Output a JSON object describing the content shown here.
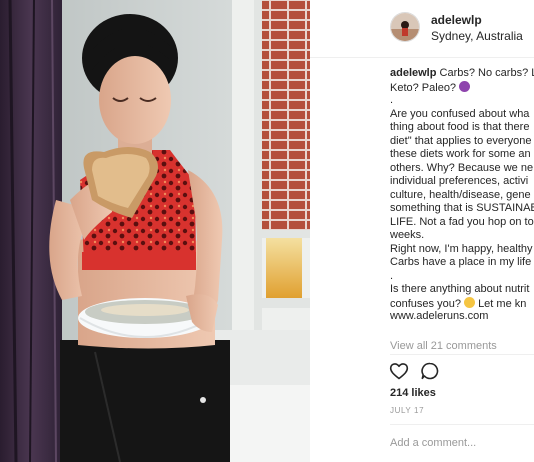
{
  "post": {
    "username": "adelewlp",
    "location": "Sydney, Australia",
    "caption_lines": [
      "Carbs? No carbs? L",
      "Keto? Paleo?",
      ".",
      "Are you confused about wha",
      "thing about food is that there",
      "diet\" that applies to everyone",
      "these diets work for some an",
      "others. Why? Because we ne",
      "individual preferences, activi",
      "culture, health/disease, gene",
      "something that is SUSTAINAB",
      "LIFE. Not a fad you hop on to",
      "weeks.",
      "Right now, I'm happy, healthy",
      "Carbs have a place in my life",
      ".",
      "Is there anything about nutrit",
      "confuses you?",
      "Let me kn",
      "www.adeleruns.com"
    ],
    "view_all_comments": "View all 21 comments",
    "likes": "214 likes",
    "date": "JULY 17",
    "add_comment_placeholder": "Add a comment..."
  },
  "icons": {
    "like": "heart-outline-icon",
    "comment": "speech-bubble-icon",
    "emoji_shrug": "woman-shrugging-emoji",
    "emoji_thinking": "thinking-face-emoji"
  },
  "colors": {
    "username_text": "#262626",
    "muted_text": "#999999",
    "divider": "#efefef",
    "photo_curtain": "#3a2a3e",
    "photo_brick": "#b4503c",
    "photo_crop_top": "#d8322e"
  }
}
